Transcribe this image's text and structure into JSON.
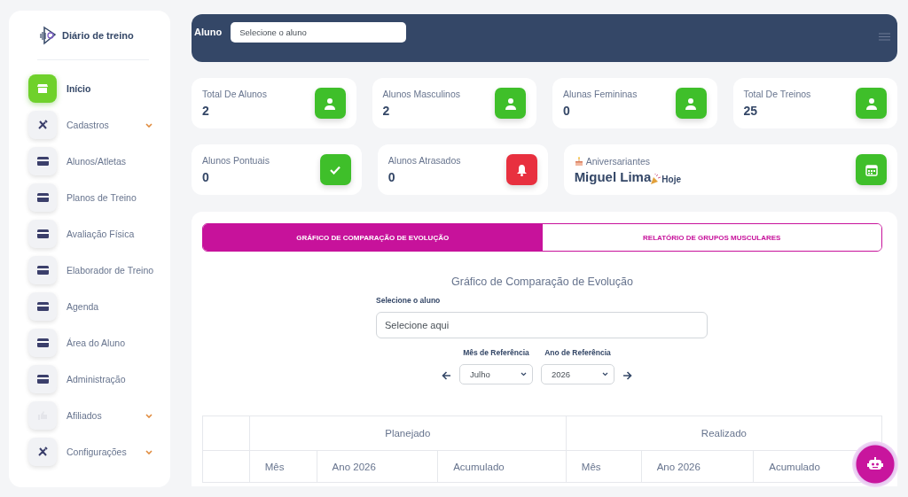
{
  "brand": {
    "name": "Diário de treino"
  },
  "sidebar": {
    "items": [
      {
        "label": "Início",
        "kind": "store",
        "selected": true,
        "expandable": false
      },
      {
        "label": "Cadastros",
        "kind": "tools",
        "selected": false,
        "expandable": true
      },
      {
        "label": "Alunos/Atletas",
        "kind": "card",
        "selected": false,
        "expandable": false
      },
      {
        "label": "Planos de Treino",
        "kind": "card",
        "selected": false,
        "expandable": false
      },
      {
        "label": "Avaliação Física",
        "kind": "card",
        "selected": false,
        "expandable": false
      },
      {
        "label": "Elaborador de Treino",
        "kind": "card",
        "selected": false,
        "expandable": false
      },
      {
        "label": "Agenda",
        "kind": "card",
        "selected": false,
        "expandable": false
      },
      {
        "label": "Área do Aluno",
        "kind": "card",
        "selected": false,
        "expandable": false
      },
      {
        "label": "Administração",
        "kind": "card",
        "selected": false,
        "expandable": false
      },
      {
        "label": "Afiliados",
        "kind": "thumb",
        "selected": false,
        "expandable": true
      },
      {
        "label": "Configurações",
        "kind": "tools",
        "selected": false,
        "expandable": true
      }
    ]
  },
  "top_bar": {
    "label": "Aluno",
    "placeholder": "Selecione o aluno"
  },
  "stats": [
    {
      "label": "Total De Alunos",
      "value": "2",
      "kind": "user",
      "color": "#3fbf2a"
    },
    {
      "label": "Alunos Masculinos",
      "value": "2",
      "kind": "user",
      "color": "#3fbf2a"
    },
    {
      "label": "Alunas Femininas",
      "value": "0",
      "kind": "user",
      "color": "#3fbf2a"
    },
    {
      "label": "Total De Treinos",
      "value": "25",
      "kind": "user",
      "color": "#3fbf2a"
    },
    {
      "label": "Alunos Pontuais",
      "value": "0",
      "kind": "check",
      "color": "#3fbf2a"
    },
    {
      "label": "Alunos Atrasados",
      "value": "0",
      "kind": "bell",
      "color": "#e8303f"
    }
  ],
  "birthdays": {
    "label": "Aniversariantes",
    "name": "Miguel Lima",
    "tag": "Hoje",
    "color": "#3fbf2a"
  },
  "tabs": [
    {
      "label": "GRÁFICO DE COMPARAÇÃO DE EVOLUÇÃO",
      "selected": true
    },
    {
      "label": "RELATÓRIO DE GRUPOS MUSCULARES",
      "selected": false
    }
  ],
  "evolution": {
    "title": "Gráfico de Comparação de Evolução",
    "student_label": "Selecione o aluno",
    "student_placeholder": "Selecione aqui",
    "month_label": "Mês de Referência",
    "month": "Julho",
    "year_label": "Ano de Referência",
    "year": "2026"
  },
  "table": {
    "groups": [
      {
        "title": "Planejado",
        "columns": [
          "Mês",
          "Ano 2026",
          "Acumulado"
        ]
      },
      {
        "title": "Realizado",
        "columns": [
          "Mês",
          "Ano 2026",
          "Acumulado"
        ]
      }
    ]
  }
}
